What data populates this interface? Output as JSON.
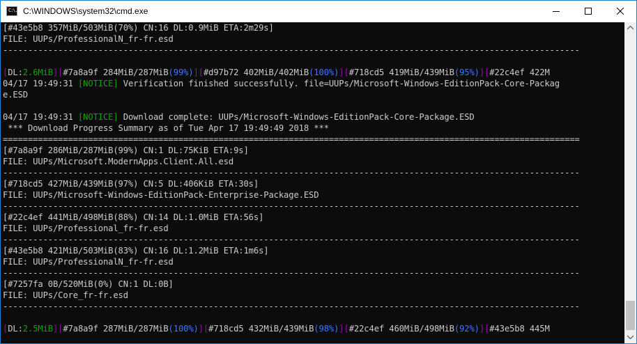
{
  "window": {
    "title": "C:\\WINDOWS\\system32\\cmd.exe",
    "icon_text": "C:\\."
  },
  "colors": {
    "text": "#cccccc",
    "green": "#13a10e",
    "blue": "#3b78ff",
    "magenta": "#881798",
    "background": "#0c0c0c"
  },
  "lines": [
    [
      {
        "t": "[#43e5b8 357MiB/503MiB(70%) CN:16 DL:0.9MiB ETA:2m29s]"
      }
    ],
    [
      {
        "t": "FILE: UUPs/ProfessionalN_fr-fr.esd"
      }
    ],
    [
      {
        "t": "-------------------------------------------------------------------------------------------------------------------"
      }
    ],
    [
      {
        "t": ""
      }
    ],
    [
      {
        "t": "[",
        "c": "magenta"
      },
      {
        "t": "DL:"
      },
      {
        "t": "2.6MiB",
        "c": "green"
      },
      {
        "t": "]",
        "c": "magenta"
      },
      {
        "t": "[",
        "c": "magenta"
      },
      {
        "t": "#7a8a9f 284MiB/287MiB"
      },
      {
        "t": "(99%)",
        "c": "blue"
      },
      {
        "t": "]",
        "c": "magenta"
      },
      {
        "t": "[",
        "c": "magenta"
      },
      {
        "t": "#d97b72 402MiB/402MiB"
      },
      {
        "t": "(100%)",
        "c": "blue"
      },
      {
        "t": "]",
        "c": "magenta"
      },
      {
        "t": "[",
        "c": "magenta"
      },
      {
        "t": "#718cd5 419MiB/439MiB"
      },
      {
        "t": "(95%)",
        "c": "blue"
      },
      {
        "t": "]",
        "c": "magenta"
      },
      {
        "t": "[",
        "c": "magenta"
      },
      {
        "t": "#22c4ef 422M"
      }
    ],
    [
      {
        "t": "04/17 19:49:31 "
      },
      {
        "t": "[",
        "c": "green"
      },
      {
        "t": "NOTICE",
        "c": "green"
      },
      {
        "t": "]",
        "c": "green"
      },
      {
        "t": " Verification finished successfully. file=UUPs/Microsoft-Windows-EditionPack-Core-Packag"
      }
    ],
    [
      {
        "t": "e.ESD"
      }
    ],
    [
      {
        "t": ""
      }
    ],
    [
      {
        "t": "04/17 19:49:31 "
      },
      {
        "t": "[",
        "c": "green"
      },
      {
        "t": "NOTICE",
        "c": "green"
      },
      {
        "t": "]",
        "c": "green"
      },
      {
        "t": " Download complete: UUPs/Microsoft-Windows-EditionPack-Core-Package.ESD"
      }
    ],
    [
      {
        "t": " *** Download Progress Summary as of Tue Apr 17 19:49:49 2018 ***"
      }
    ],
    [
      {
        "t": "==================================================================================================================="
      }
    ],
    [
      {
        "t": "[#7a8a9f 286MiB/287MiB(99%) CN:1 DL:75KiB ETA:9s]"
      }
    ],
    [
      {
        "t": "FILE: UUPs/Microsoft.ModernApps.Client.All.esd"
      }
    ],
    [
      {
        "t": "-------------------------------------------------------------------------------------------------------------------"
      }
    ],
    [
      {
        "t": "[#718cd5 427MiB/439MiB(97%) CN:5 DL:406KiB ETA:30s]"
      }
    ],
    [
      {
        "t": "FILE: UUPs/Microsoft-Windows-EditionPack-Enterprise-Package.ESD"
      }
    ],
    [
      {
        "t": "-------------------------------------------------------------------------------------------------------------------"
      }
    ],
    [
      {
        "t": "[#22c4ef 441MiB/498MiB(88%) CN:14 DL:1.0MiB ETA:56s]"
      }
    ],
    [
      {
        "t": "FILE: UUPs/Professional_fr-fr.esd"
      }
    ],
    [
      {
        "t": "-------------------------------------------------------------------------------------------------------------------"
      }
    ],
    [
      {
        "t": "[#43e5b8 421MiB/503MiB(83%) CN:16 DL:1.2MiB ETA:1m6s]"
      }
    ],
    [
      {
        "t": "FILE: UUPs/ProfessionalN_fr-fr.esd"
      }
    ],
    [
      {
        "t": "-------------------------------------------------------------------------------------------------------------------"
      }
    ],
    [
      {
        "t": "[#7257fa 0B/520MiB(0%) CN:1 DL:0B]"
      }
    ],
    [
      {
        "t": "FILE: UUPs/Core_fr-fr.esd"
      }
    ],
    [
      {
        "t": "-------------------------------------------------------------------------------------------------------------------"
      }
    ],
    [
      {
        "t": ""
      }
    ],
    [
      {
        "t": "[",
        "c": "magenta"
      },
      {
        "t": "DL:"
      },
      {
        "t": "2.5MiB",
        "c": "green"
      },
      {
        "t": "]",
        "c": "magenta"
      },
      {
        "t": "[",
        "c": "magenta"
      },
      {
        "t": "#7a8a9f 287MiB/287MiB"
      },
      {
        "t": "(100%)",
        "c": "blue"
      },
      {
        "t": "]",
        "c": "magenta"
      },
      {
        "t": "[",
        "c": "magenta"
      },
      {
        "t": "#718cd5 432MiB/439MiB"
      },
      {
        "t": "(98%)",
        "c": "blue"
      },
      {
        "t": "]",
        "c": "magenta"
      },
      {
        "t": "[",
        "c": "magenta"
      },
      {
        "t": "#22c4ef 460MiB/498MiB"
      },
      {
        "t": "(92%)",
        "c": "blue"
      },
      {
        "t": "]",
        "c": "magenta"
      },
      {
        "t": "[",
        "c": "magenta"
      },
      {
        "t": "#43e5b8 445M"
      }
    ]
  ]
}
